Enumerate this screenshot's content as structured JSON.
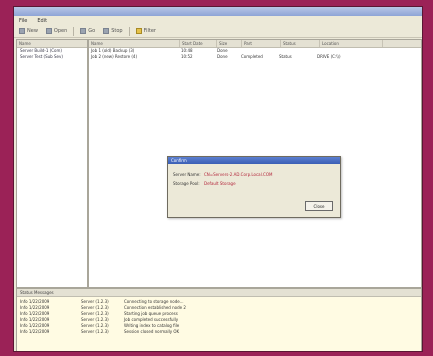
{
  "menu": [
    "File",
    "Edit"
  ],
  "toolbar": {
    "btn_new": "New",
    "btn_open": "Open",
    "btn_run": "Go",
    "btn_stop": "Stop",
    "btn_filter": "Filter"
  },
  "tree": {
    "header": "Name",
    "items": [
      "Server Build-1 (Com)",
      "Server Test (Sub Sev)"
    ]
  },
  "table": {
    "headers": [
      "Name",
      "Start Date",
      "Size",
      "Part",
      "Status",
      "Location"
    ],
    "rows": [
      [
        "Job 1 (old) Backup (3)",
        "10:48",
        "Done",
        "",
        "",
        ""
      ],
      [
        "Job 2 (new) Restore (4)",
        "10:52",
        "Done",
        "Completed",
        "Status",
        "DRIVE (C:\\\\)"
      ]
    ]
  },
  "dialog": {
    "title": "Confirm",
    "rows": [
      {
        "label": "Server Name:",
        "value": "CN=Servers-2.AD.Corp.Local.COM"
      },
      {
        "label": "Storage Pool:",
        "value": "Default Storage"
      }
    ],
    "ok_label": "Close"
  },
  "log": {
    "title": "Status Messages",
    "entries": [
      [
        "Info 1/22/2009",
        "Server (1.2.3)",
        "Connecting to storage node..."
      ],
      [
        "Info 1/22/2009",
        "Server (1.2.3)",
        "Connection established node 2"
      ],
      [
        "Info 1/22/2009",
        "Server (1.2.3)",
        "Starting job queue process"
      ],
      [
        "Info 1/22/2009",
        "Server (1.2.3)",
        "Job completed successfully"
      ],
      [
        "Info 1/22/2009",
        "Server (1.2.3)",
        "Writing index to catalog file"
      ],
      [
        "Info 1/22/2009",
        "Server (1.2.3)",
        "Session closed normally OK"
      ]
    ]
  }
}
